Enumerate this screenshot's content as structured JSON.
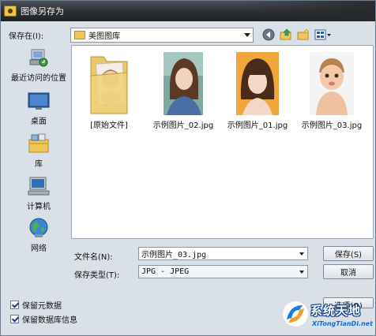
{
  "window": {
    "title": "图像另存为"
  },
  "toolbar": {
    "save_in_label": "保存在(I):",
    "location": "美图图库"
  },
  "places": [
    {
      "label": "最近访问的位置",
      "icon": "recent-places-icon"
    },
    {
      "label": "桌面",
      "icon": "desktop-icon"
    },
    {
      "label": "库",
      "icon": "library-icon"
    },
    {
      "label": "计算机",
      "icon": "computer-icon"
    },
    {
      "label": "网络",
      "icon": "network-icon"
    }
  ],
  "files": [
    {
      "name": "[原始文件]",
      "kind": "folder"
    },
    {
      "name": "示例图片_02.jpg",
      "kind": "image"
    },
    {
      "name": "示例图片_01.jpg",
      "kind": "image"
    },
    {
      "name": "示例图片_03.jpg",
      "kind": "image"
    }
  ],
  "form": {
    "filename_label": "文件名(N):",
    "filename_value": "示例图片_03.jpg",
    "filetype_label": "保存类型(T):",
    "filetype_value": "JPG - JPEG",
    "save_button": "保存(S)",
    "cancel_button": "取消",
    "options_button": "选项(O)"
  },
  "checkboxes": [
    {
      "label": "保留元数据",
      "checked": true
    },
    {
      "label": "保留数据库信息",
      "checked": true
    }
  ],
  "watermark": {
    "title": "系统天地",
    "url": "XiTongTianDi.net"
  },
  "colors": {
    "titlebar": "#2b2e33",
    "dialog_bg": "#d9e0e8",
    "watermark_blue": "#0b6fd8"
  }
}
